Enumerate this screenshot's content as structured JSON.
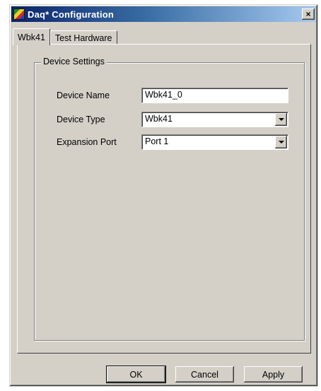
{
  "window": {
    "title": "Daq* Configuration",
    "close_label": "×"
  },
  "tabs": [
    {
      "label": "Wbk41",
      "active": true
    },
    {
      "label": "Test Hardware",
      "active": false
    }
  ],
  "device_settings": {
    "legend": "Device Settings",
    "device_name": {
      "label": "Device Name",
      "value": "Wbk41_0"
    },
    "device_type": {
      "label": "Device Type",
      "value": "Wbk41"
    },
    "expansion_port": {
      "label": "Expansion Port",
      "value": "Port 1"
    }
  },
  "buttons": {
    "ok": "OK",
    "cancel": "Cancel",
    "apply": "Apply"
  },
  "icons": {
    "app": "daq-app-icon",
    "close": "close-icon",
    "dropdown": "chevron-down-icon"
  }
}
